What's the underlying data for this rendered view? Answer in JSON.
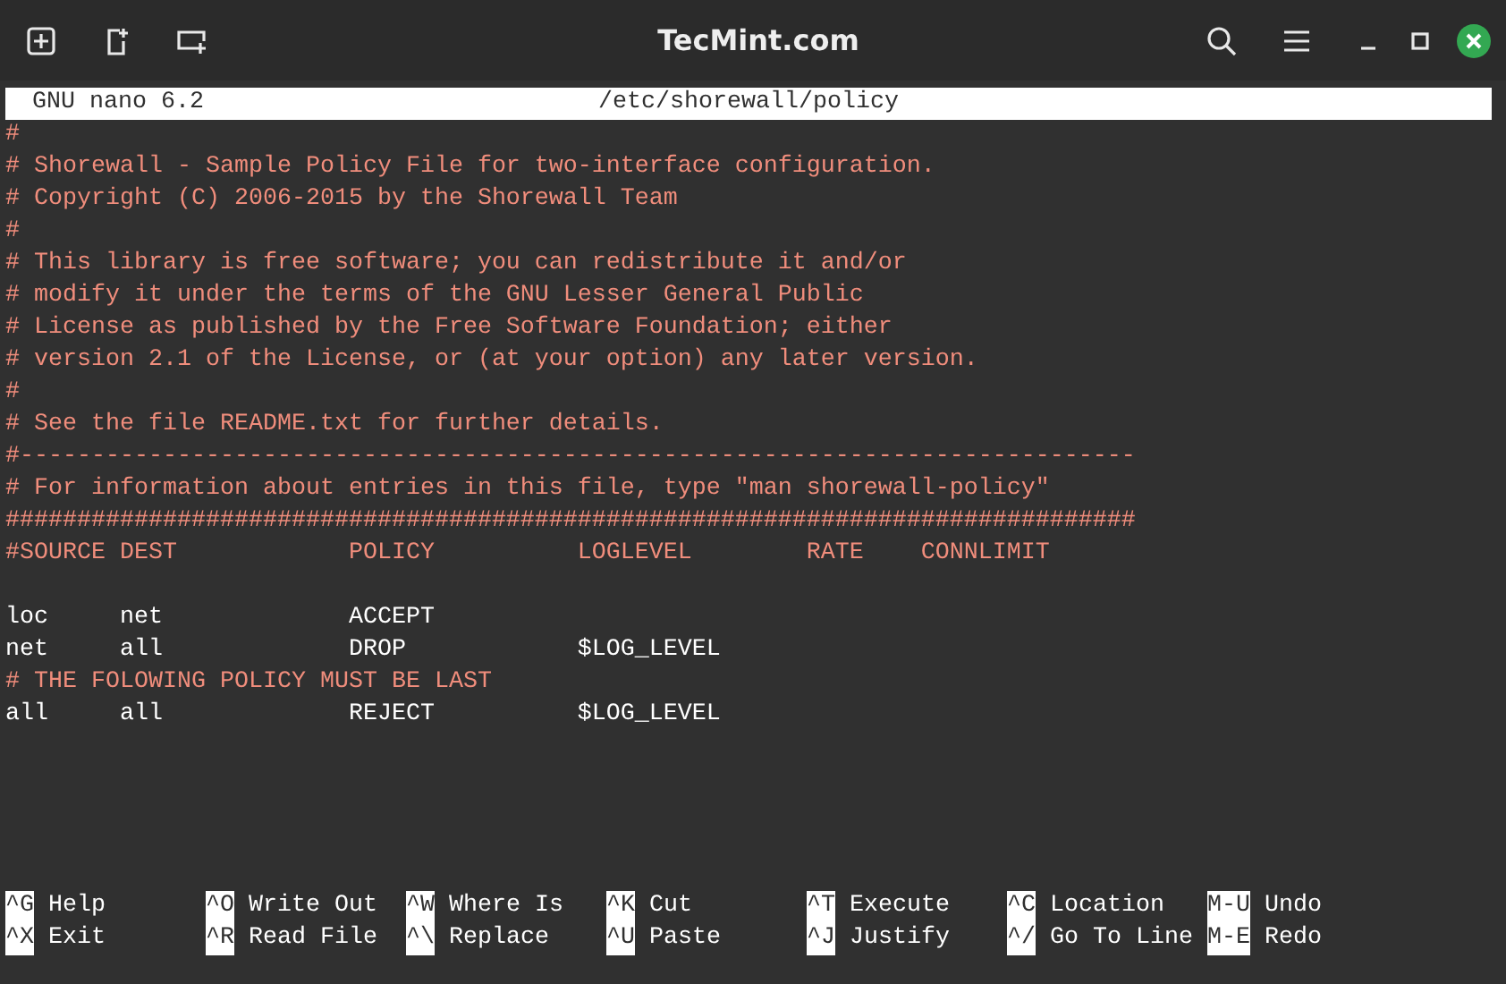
{
  "window": {
    "title": "TecMint.com"
  },
  "editor": {
    "app": "GNU nano 6.2",
    "file": "/etc/shorewall/policy"
  },
  "lines": [
    {
      "kind": "comment",
      "text": "#"
    },
    {
      "kind": "comment",
      "text": "# Shorewall - Sample Policy File for two-interface configuration."
    },
    {
      "kind": "comment",
      "text": "# Copyright (C) 2006-2015 by the Shorewall Team"
    },
    {
      "kind": "comment",
      "text": "#"
    },
    {
      "kind": "comment",
      "text": "# This library is free software; you can redistribute it and/or"
    },
    {
      "kind": "comment",
      "text": "# modify it under the terms of the GNU Lesser General Public"
    },
    {
      "kind": "comment",
      "text": "# License as published by the Free Software Foundation; either"
    },
    {
      "kind": "comment",
      "text": "# version 2.1 of the License, or (at your option) any later version."
    },
    {
      "kind": "comment",
      "text": "#"
    },
    {
      "kind": "comment",
      "text": "# See the file README.txt for further details."
    },
    {
      "kind": "comment",
      "text": "#------------------------------------------------------------------------------"
    },
    {
      "kind": "comment",
      "text": "# For information about entries in this file, type \"man shorewall-policy\""
    },
    {
      "kind": "comment",
      "text": "###############################################################################"
    },
    {
      "kind": "comment",
      "text": "#SOURCE DEST            POLICY          LOGLEVEL        RATE    CONNLIMIT"
    },
    {
      "kind": "blank"
    },
    {
      "kind": "code",
      "text": "loc     net             ACCEPT"
    },
    {
      "kind": "code",
      "text": "net     all             DROP            $LOG_LEVEL"
    },
    {
      "kind": "comment",
      "text": "# THE FOLOWING POLICY MUST BE LAST"
    },
    {
      "kind": "code",
      "text": "all     all             REJECT          $LOG_LEVEL"
    }
  ],
  "shortcut_rows": [
    [
      {
        "key": "^G",
        "label": "Help"
      },
      {
        "key": "^O",
        "label": "Write Out"
      },
      {
        "key": "^W",
        "label": "Where Is"
      },
      {
        "key": "^K",
        "label": "Cut"
      },
      {
        "key": "^T",
        "label": "Execute"
      },
      {
        "key": "^C",
        "label": "Location"
      },
      {
        "key": "M-U",
        "label": "Undo"
      }
    ],
    [
      {
        "key": "^X",
        "label": "Exit"
      },
      {
        "key": "^R",
        "label": "Read File"
      },
      {
        "key": "^\\",
        "label": "Replace"
      },
      {
        "key": "^U",
        "label": "Paste"
      },
      {
        "key": "^J",
        "label": "Justify"
      },
      {
        "key": "^/",
        "label": "Go To Line"
      },
      {
        "key": "M-E",
        "label": "Redo"
      }
    ]
  ]
}
